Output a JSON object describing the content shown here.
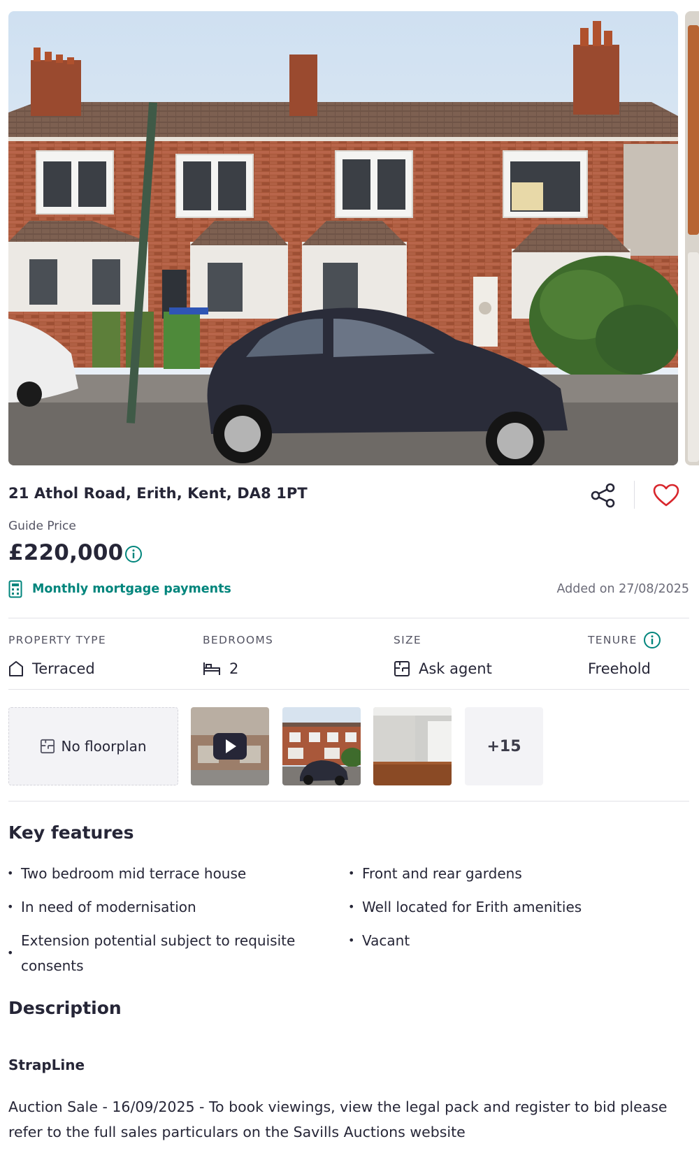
{
  "listing": {
    "address": "21 Athol Road, Erith, Kent, DA8 1PT",
    "price_label": "Guide Price",
    "price": "£220,000",
    "mortgage_label": "Monthly mortgage payments",
    "added": "Added on 27/08/2025"
  },
  "stats": {
    "property_type": {
      "label": "PROPERTY TYPE",
      "value": "Terraced",
      "icon": "house-icon"
    },
    "bedrooms": {
      "label": "BEDROOMS",
      "value": "2",
      "icon": "bed-icon"
    },
    "size": {
      "label": "SIZE",
      "value": "Ask agent",
      "icon": "floorplan-icon"
    },
    "tenure": {
      "label": "TENURE",
      "value": "Freehold",
      "icon": "info-icon"
    }
  },
  "media": {
    "floorplan_label": "No floorplan",
    "more_count": "+15"
  },
  "features": {
    "title": "Key features",
    "left": [
      "Two bedroom mid terrace house",
      "In need of modernisation",
      "Extension potential subject to requisite consents"
    ],
    "right": [
      "Front and rear gardens",
      "Well located for Erith amenities",
      "Vacant"
    ]
  },
  "description": {
    "title": "Description",
    "strapline_title": "StrapLine",
    "strapline_text": "Auction Sale - 16/09/2025 - To book viewings, view the legal pack and register to bid please refer to the full sales particulars on the Savills Auctions website"
  },
  "colors": {
    "accent": "#00857c",
    "text": "#262637",
    "heart": "#d8262c"
  }
}
